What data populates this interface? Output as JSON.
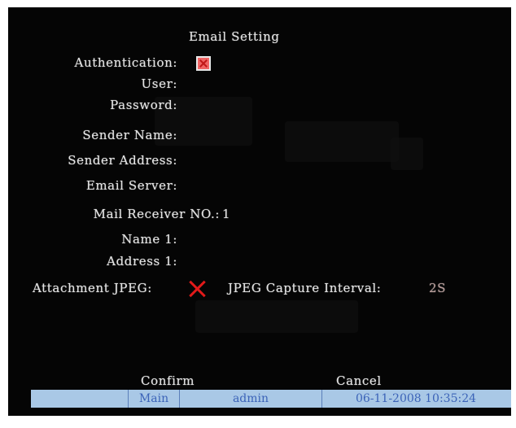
{
  "dialog": {
    "title": "Email Setting"
  },
  "fields": {
    "authentication": {
      "label": "Authentication:",
      "checked": true
    },
    "user": {
      "label": "User:",
      "value": ""
    },
    "password": {
      "label": "Password:",
      "value": ""
    },
    "sender_name": {
      "label": "Sender Name:",
      "value": ""
    },
    "sender_address": {
      "label": "Sender Address:",
      "value": ""
    },
    "email_server": {
      "label": "Email Server:",
      "value": ""
    },
    "mail_receiver_no": {
      "label": "Mail Receiver NO.:",
      "value": "1"
    },
    "name1": {
      "label": "Name 1:",
      "value": ""
    },
    "address1": {
      "label": "Address 1:",
      "value": ""
    },
    "attachment_jpeg": {
      "label": "Attachment JPEG:",
      "checked": false
    },
    "jpeg_capture_interval": {
      "label": "JPEG Capture Interval:",
      "value": "2S"
    }
  },
  "buttons": {
    "confirm": "Confirm",
    "cancel": "Cancel"
  },
  "status_bar": {
    "blank": "",
    "menu": "Main",
    "user": "admin",
    "datetime": "06-11-2008 10:35:24"
  },
  "colors": {
    "background": "#050505",
    "text": "#e4e4e4",
    "checkbox_fill": "#f06464",
    "x_mark": "#e11a1a",
    "status_bar": "#a9c8e6",
    "status_text": "#3b63b8"
  }
}
